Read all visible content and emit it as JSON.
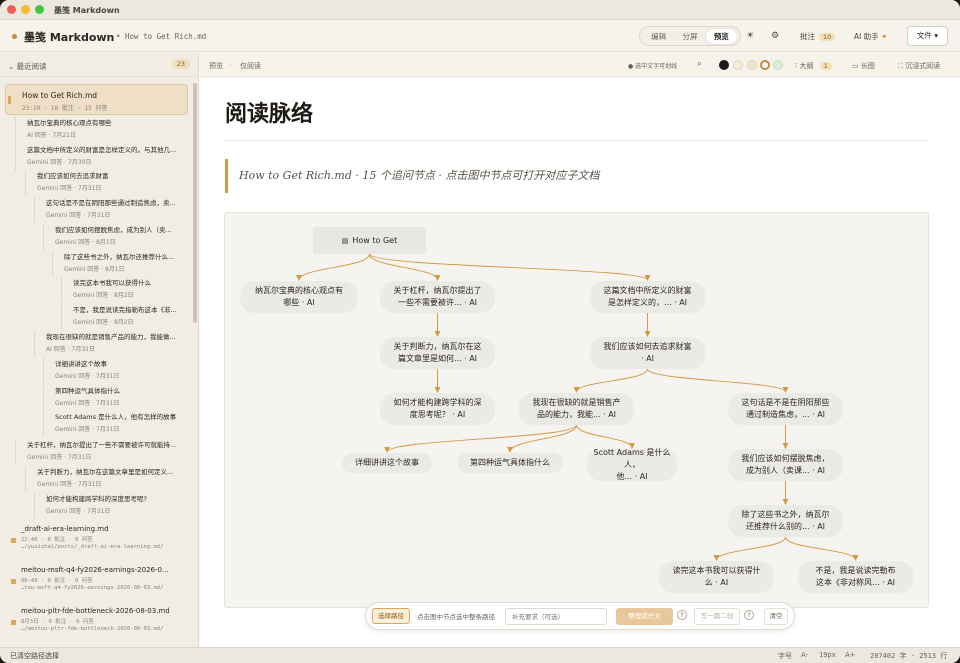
{
  "window": {
    "title": "墨笺 Markdown"
  },
  "app": {
    "brand": "墨笺 Markdown",
    "doc_title": "How to Get Rich.md"
  },
  "modes": [
    "编辑",
    "分屏",
    "预览"
  ],
  "mode_active": "预览",
  "header": {
    "theme_icon": "sun-icon",
    "settings_icon": "gear-icon",
    "notes_label": "批注",
    "notes_count": "10",
    "ai_label": "AI 助手",
    "ai_icon": "sparkle-icon",
    "file_label": "文件"
  },
  "sidebar": {
    "section_label": "最近阅读",
    "count": "23",
    "selected": {
      "title": "How to Get Rich.md",
      "meta": "23:19 · 10 批注 · 15 问答"
    },
    "threads": [
      {
        "title": "纳瓦尔宝典的核心观点有哪些",
        "meta": "AI 回答 · 7月21日"
      },
      {
        "title": "这篇文档中所定义的财富是怎样定义的。与其他几...",
        "meta": "Gemini 回答 · 7月30日"
      },
      {
        "title": "我们应该如何去追求财富",
        "meta": "Gemini 回答 · 7月31日"
      },
      {
        "title": "这句话是不是在阴阳那些通过制造焦虑，卖...",
        "meta": "Gemini 回答 · 7月31日"
      },
      {
        "title": "我们应该如何摆脱焦虑，成为别人（卖...",
        "meta": "Gemini 回答 · 8月1日"
      },
      {
        "title": "除了这些书之外，纳瓦尔还推荐什么...",
        "meta": "Gemini 回答 · 8月1日"
      },
      {
        "title": "读完这本书我可以获得什么",
        "meta": "Gemini 回答 · 8月2日"
      },
      {
        "title": "不是，我是说读完指勒布这本《非...",
        "meta": "Gemini 回答 · 8月2日"
      },
      {
        "title": "我现在很缺的就是销售产品的能力，我能做...",
        "meta": "AI 回答 · 7月31日"
      },
      {
        "title": "详细讲讲这个故事",
        "meta": "Gemini 回答 · 7月31日"
      },
      {
        "title": "第四种运气具体指什么",
        "meta": "Gemini 回答 · 7月31日"
      },
      {
        "title": "Scott Adams 是什么人，他有怎样的故事",
        "meta": "Gemini 回答 · 7月31日"
      },
      {
        "title": "关于杠杆，纳瓦尔提出了一些不需要被许可就能持...",
        "meta": "Gemini 回答 · 7月31日"
      },
      {
        "title": "关于判断力，纳瓦尔在这篇文章里是如何定义...",
        "meta": "Gemini 回答 · 7月31日"
      },
      {
        "title": "如何才能构建跨学科的深度思考呢?",
        "meta": "Gemini 回答 · 7月31日"
      }
    ],
    "docs": [
      {
        "title": "_draft-ai-era-learning.md",
        "meta": "22:40 · 0 批注 · 0 问答",
        "path": "…/yuxizhai/posts/_draft-ai-era-learning.md/"
      },
      {
        "title": "meitou-msft-q4-fy2026-earnings-2026-0...",
        "meta": "06:49 · 0 批注 · 0 问答",
        "path": "…tou-msft-q4-fy2026-earnings-2026-08-03.md/"
      },
      {
        "title": "meitou-pltr-fde-bottleneck-2026-08-03.md",
        "meta": "8月3日 · 0 批注 · 0 问答",
        "path": "…/meitou-pltr-fde-bottleneck-2026-08-03.md/"
      }
    ]
  },
  "toolbar": {
    "crumb1": "预览",
    "crumb2": "仅阅读",
    "hint": "选中文字可划线",
    "outline_label": "大纲",
    "outline_count": "1",
    "longimg_label": "长图",
    "immersive_label": "沉浸式阅读",
    "swatches": [
      "#1a1a1a",
      "#f5ecd8",
      "#f1e6cf",
      "#ffffff",
      "#dcebd6"
    ]
  },
  "page": {
    "title": "阅读脉络",
    "subtitle": "How to Get Rich.md · 15 个追问节点 · 点击图中节点可打开对应子文档"
  },
  "graph": {
    "root": "How to Get",
    "nodes": [
      {
        "id": "n1",
        "l1": "纳瓦尔宝典的核心观点有",
        "l2": "哪些 · AI"
      },
      {
        "id": "n2",
        "l1": "关于杠杆，纳瓦尔提出了",
        "l2": "一些不需要被许... · AI"
      },
      {
        "id": "n3",
        "l1": "这篇文档中所定义的财富",
        "l2": "是怎样定义的，... · AI"
      },
      {
        "id": "n4",
        "l1": "关于判断力，纳瓦尔在这",
        "l2": "篇文章里是如何... · AI"
      },
      {
        "id": "n5",
        "l1": "我们应该如何去追求财富",
        "l2": "· AI"
      },
      {
        "id": "n6",
        "l1": "如何才能构建跨学科的深",
        "l2": "度思考呢？ · AI"
      },
      {
        "id": "n7",
        "l1": "我现在很缺的就是销售产",
        "l2": "品的能力，我能... · AI"
      },
      {
        "id": "n8",
        "l1": "这句话是不是在阴阳那些",
        "l2": "通过制造焦虑，... · AI"
      },
      {
        "id": "n9",
        "l1": "详细讲讲这个故事",
        "l2": ""
      },
      {
        "id": "n10",
        "l1": "第四种运气具体指什么",
        "l2": ""
      },
      {
        "id": "n11",
        "l1": "Scott Adams 是什么人，",
        "l2": "他... · AI"
      },
      {
        "id": "n12",
        "l1": "我们应该如何摆脱焦虑，",
        "l2": "成为别人（卖课... · AI"
      },
      {
        "id": "n13",
        "l1": "除了这些书之外，纳瓦尔",
        "l2": "还推荐什么别的... · AI"
      },
      {
        "id": "n14",
        "l1": "读完这本书我可以获得什",
        "l2": "么 · AI"
      },
      {
        "id": "n15",
        "l1": "不是，我是说读完勒布",
        "l2": "这本《非对称风... · AI"
      }
    ]
  },
  "bottom_bar": {
    "select_path": "选择路径",
    "hint": "点击图中节点选中整条路径",
    "placeholder": "补充要求（可选）",
    "generate": "整理成长文",
    "help": "?",
    "another": "写一篇二创",
    "clear": "清空"
  },
  "status": {
    "left": "已清空路径选择",
    "font_label": "字号",
    "font_minus": "A-",
    "font_size": "19px",
    "font_plus": "A+",
    "stats": "207402 字 · 2513 行"
  }
}
